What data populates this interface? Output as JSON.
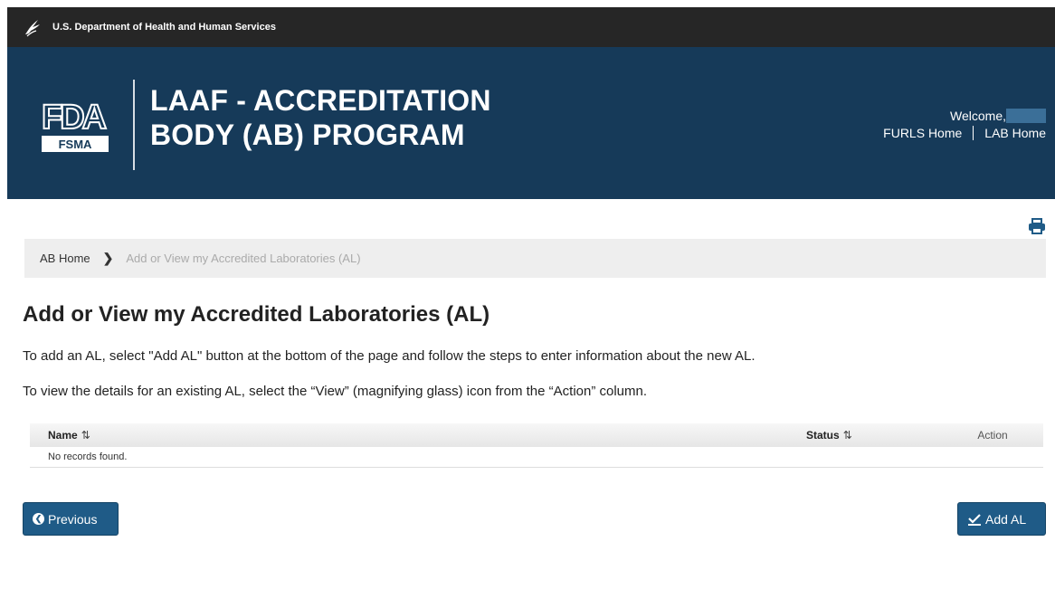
{
  "hhs_bar": {
    "text": "U.S. Department of Health and Human Services",
    "icon": "hhs-eagle-icon"
  },
  "banner": {
    "logo_text": "FDA",
    "logo_sub": "FSMA",
    "title_line1": "LAAF - ACCREDITATION",
    "title_line2": "BODY (AB) PROGRAM",
    "welcome": "Welcome,",
    "links": [
      "FURLS Home",
      "LAB Home"
    ]
  },
  "breadcrumb": {
    "home": "AB Home",
    "current": "Add or View my Accredited Laboratories (AL)"
  },
  "page": {
    "heading": "Add or View my Accredited Laboratories (AL)",
    "instruction1": "To add an AL, select \"Add AL\" button at the bottom of the page and follow the steps to enter information about the new AL.",
    "instruction2": "To view the details for an existing AL, select the “View” (magnifying glass) icon from the “Action” column."
  },
  "table": {
    "columns": [
      "Name",
      "Status",
      "Action"
    ],
    "empty_message": "No records found."
  },
  "buttons": {
    "previous": "Previous",
    "add": "Add AL"
  },
  "colors": {
    "banner": "#163a59",
    "button": "#1f5b87",
    "topbar": "#262626"
  }
}
